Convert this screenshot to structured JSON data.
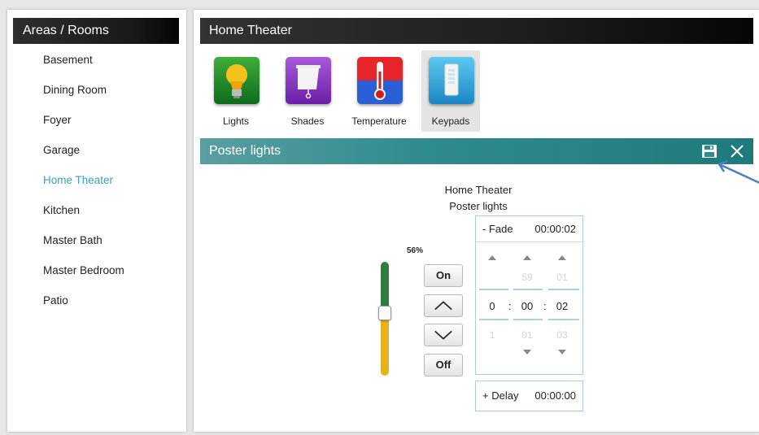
{
  "sidebar": {
    "title": "Areas / Rooms",
    "items": [
      {
        "label": "Basement"
      },
      {
        "label": "Dining Room"
      },
      {
        "label": "Foyer"
      },
      {
        "label": "Garage"
      },
      {
        "label": "Home Theater",
        "active": true
      },
      {
        "label": "Kitchen"
      },
      {
        "label": "Master Bath"
      },
      {
        "label": "Master Bedroom"
      },
      {
        "label": "Patio"
      }
    ]
  },
  "main": {
    "title": "Home Theater",
    "categories": [
      {
        "label": "Lights",
        "icon": "light-bulb-icon"
      },
      {
        "label": "Shades",
        "icon": "shades-icon"
      },
      {
        "label": "Temperature",
        "icon": "thermometer-icon"
      },
      {
        "label": "Keypads",
        "icon": "keypad-icon",
        "selected": true
      }
    ],
    "device_panel": {
      "title": "Poster lights",
      "save_icon": "save-icon",
      "close_icon": "close-icon",
      "room": "Home Theater",
      "device": "Poster lights",
      "level_percent": "56%",
      "level_value": 0.56,
      "on_label": "On",
      "off_label": "Off",
      "up_icon": "chevron-up-icon",
      "down_icon": "chevron-down-icon",
      "fade": {
        "label": "- Fade",
        "value": "00:00:02",
        "above": [
          "",
          "59",
          "01"
        ],
        "current": [
          "0",
          "00",
          "02"
        ],
        "below": [
          "1",
          "01",
          "03"
        ]
      },
      "delay": {
        "label": "+ Delay",
        "value": "00:00:00"
      }
    }
  },
  "colors": {
    "accent": "#3aa4b5",
    "teal_header": "#2f8c8e",
    "slider_top": "#2e7d3a",
    "slider_bottom": "#e6b21c"
  }
}
